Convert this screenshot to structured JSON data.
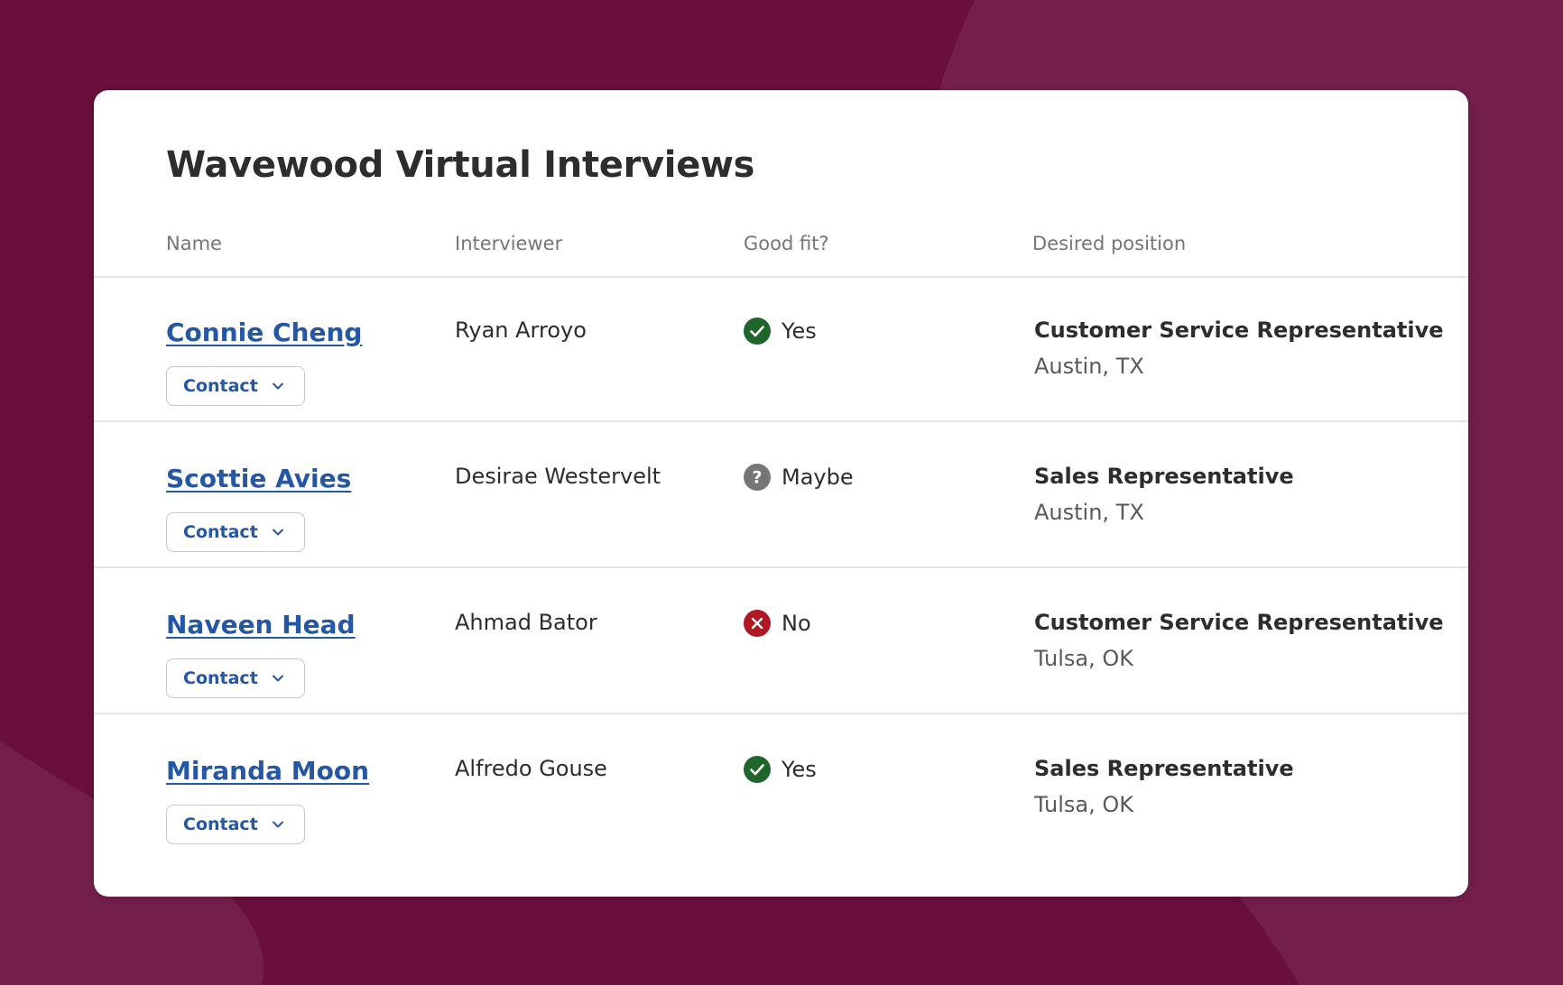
{
  "card": {
    "title": "Wavewood Virtual Interviews"
  },
  "columns": {
    "name": "Name",
    "interviewer": "Interviewer",
    "good_fit": "Good fit?",
    "desired_position": "Desired position"
  },
  "rows": [
    {
      "name": "Connie Cheng",
      "contact_label": "Contact",
      "interviewer": "Ryan Arroyo",
      "fit": "Yes",
      "fit_icon": "check-circle-icon",
      "position": "Customer Service Representative",
      "location": "Austin, TX"
    },
    {
      "name": "Scottie Avies",
      "contact_label": "Contact",
      "interviewer": "Desirae Westervelt",
      "fit": "Maybe",
      "fit_icon": "question-circle-icon",
      "position": "Sales Representative",
      "location": "Austin, TX"
    },
    {
      "name": "Naveen Head",
      "contact_label": "Contact",
      "interviewer": "Ahmad Bator",
      "fit": "No",
      "fit_icon": "x-circle-icon",
      "position": "Customer Service Representative",
      "location": "Tulsa, OK"
    },
    {
      "name": "Miranda Moon",
      "contact_label": "Contact",
      "interviewer": "Alfredo Gouse",
      "fit": "Yes",
      "fit_icon": "check-circle-icon",
      "position": "Sales Representative",
      "location": "Tulsa, OK"
    }
  ],
  "colors": {
    "background": "#741f4b",
    "background_dark": "#6a0f3b",
    "link": "#2557a7",
    "yes": "#1f662c",
    "maybe": "#767676",
    "no": "#b01825"
  }
}
